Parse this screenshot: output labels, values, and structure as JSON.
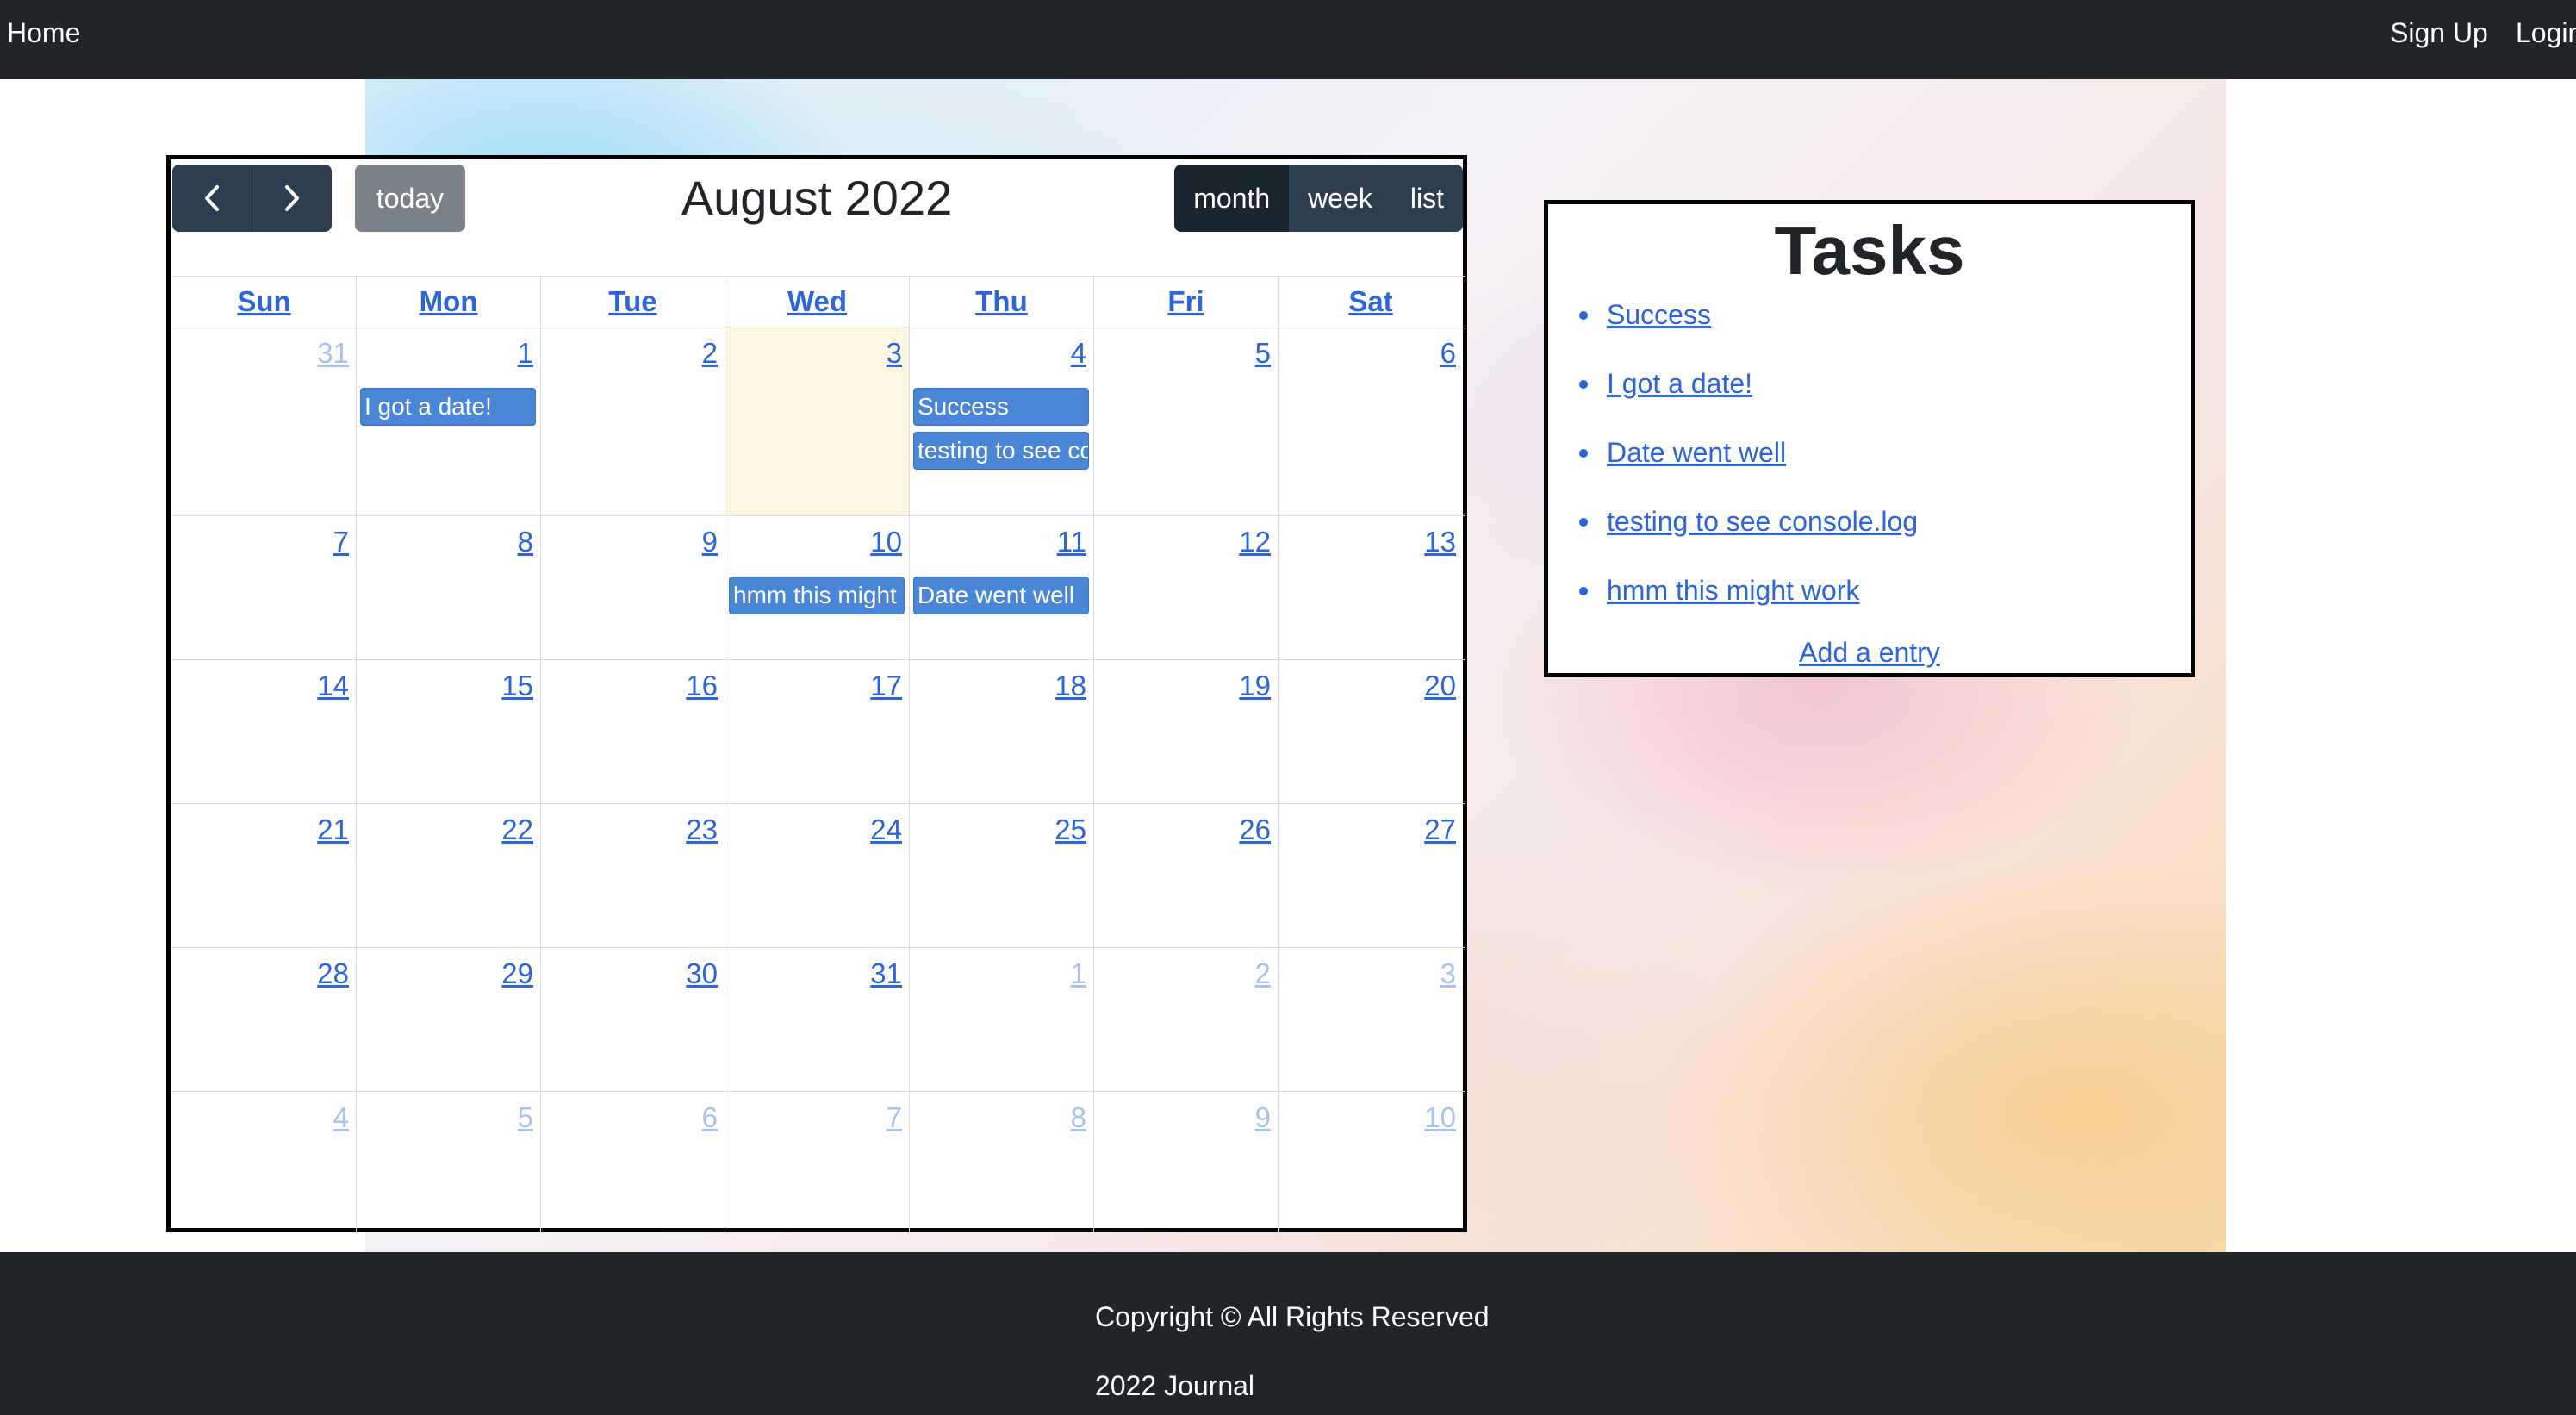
{
  "nav": {
    "home": "Home",
    "signup": "Sign Up",
    "login": "Login"
  },
  "calendar": {
    "title": "August 2022",
    "prev_icon": "chevron-left-icon",
    "next_icon": "chevron-right-icon",
    "today_label": "today",
    "views": [
      "month",
      "week",
      "list"
    ],
    "active_view": "month",
    "weekdays": [
      "Sun",
      "Mon",
      "Tue",
      "Wed",
      "Thu",
      "Fri",
      "Sat"
    ],
    "weeks": [
      [
        "31",
        "1",
        "2",
        "3",
        "4",
        "5",
        "6"
      ],
      [
        "7",
        "8",
        "9",
        "10",
        "11",
        "12",
        "13"
      ],
      [
        "14",
        "15",
        "16",
        "17",
        "18",
        "19",
        "20"
      ],
      [
        "21",
        "22",
        "23",
        "24",
        "25",
        "26",
        "27"
      ],
      [
        "28",
        "29",
        "30",
        "31",
        "1",
        "2",
        "3"
      ],
      [
        "4",
        "5",
        "6",
        "7",
        "8",
        "9",
        "10"
      ]
    ],
    "today_date": "3",
    "events": {
      "aug1": "I got a date!",
      "aug4_a": "Success",
      "aug4_b": "testing to see console.log",
      "aug10": "hmm this might work",
      "aug11": "Date went well"
    },
    "event_color": "#4a86d6",
    "today_highlight": "#fdf7e2"
  },
  "tasks": {
    "title": "Tasks",
    "items": [
      "Success",
      "I got a date!",
      "Date went well",
      "testing to see console.log",
      "hmm this might work"
    ],
    "add_entry": "Add a entry"
  },
  "footer": {
    "copyright": "Copyright © All Rights Reserved",
    "journal": "2022 Journal"
  }
}
